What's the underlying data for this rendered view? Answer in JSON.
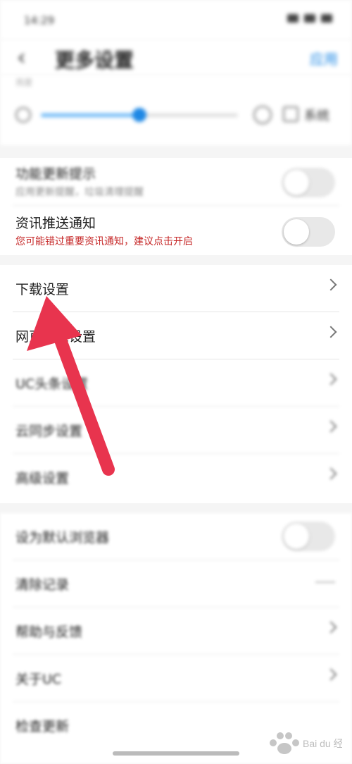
{
  "status_bar": {
    "time": "14:29"
  },
  "header": {
    "title": "更多设置",
    "action": "应用"
  },
  "brightness": {
    "caption": "亮度",
    "auto_label": "系统",
    "level": 0.5
  },
  "notify_items": [
    {
      "title": "功能更新提示",
      "subtitle": "应用更新提醒，垃圾清理提醒",
      "subtitle_red": false,
      "toggle_on": false
    },
    {
      "title": "资讯推送通知",
      "subtitle": "您可能错过重要资讯通知，建议点击开启",
      "subtitle_red": true,
      "toggle_on": false
    }
  ],
  "menu_items": [
    {
      "label": "下载设置"
    },
    {
      "label": "网页浏览设置"
    },
    {
      "label": "UC头条设置"
    },
    {
      "label": "云同步设置"
    },
    {
      "label": "高级设置"
    }
  ],
  "menu2_items": [
    {
      "label": "设为默认浏览器",
      "control": "toggle"
    },
    {
      "label": "清除记录",
      "control": "dash"
    },
    {
      "label": "帮助与反馈",
      "control": "chevron"
    },
    {
      "label": "关于UC",
      "control": "chevron"
    },
    {
      "label": "检查更新",
      "control": "chevron"
    }
  ],
  "watermark": {
    "text": "Bai du 经验"
  },
  "colors": {
    "accent": "#1e88e5",
    "warning": "#c62828",
    "arrow": "#e8344e"
  }
}
